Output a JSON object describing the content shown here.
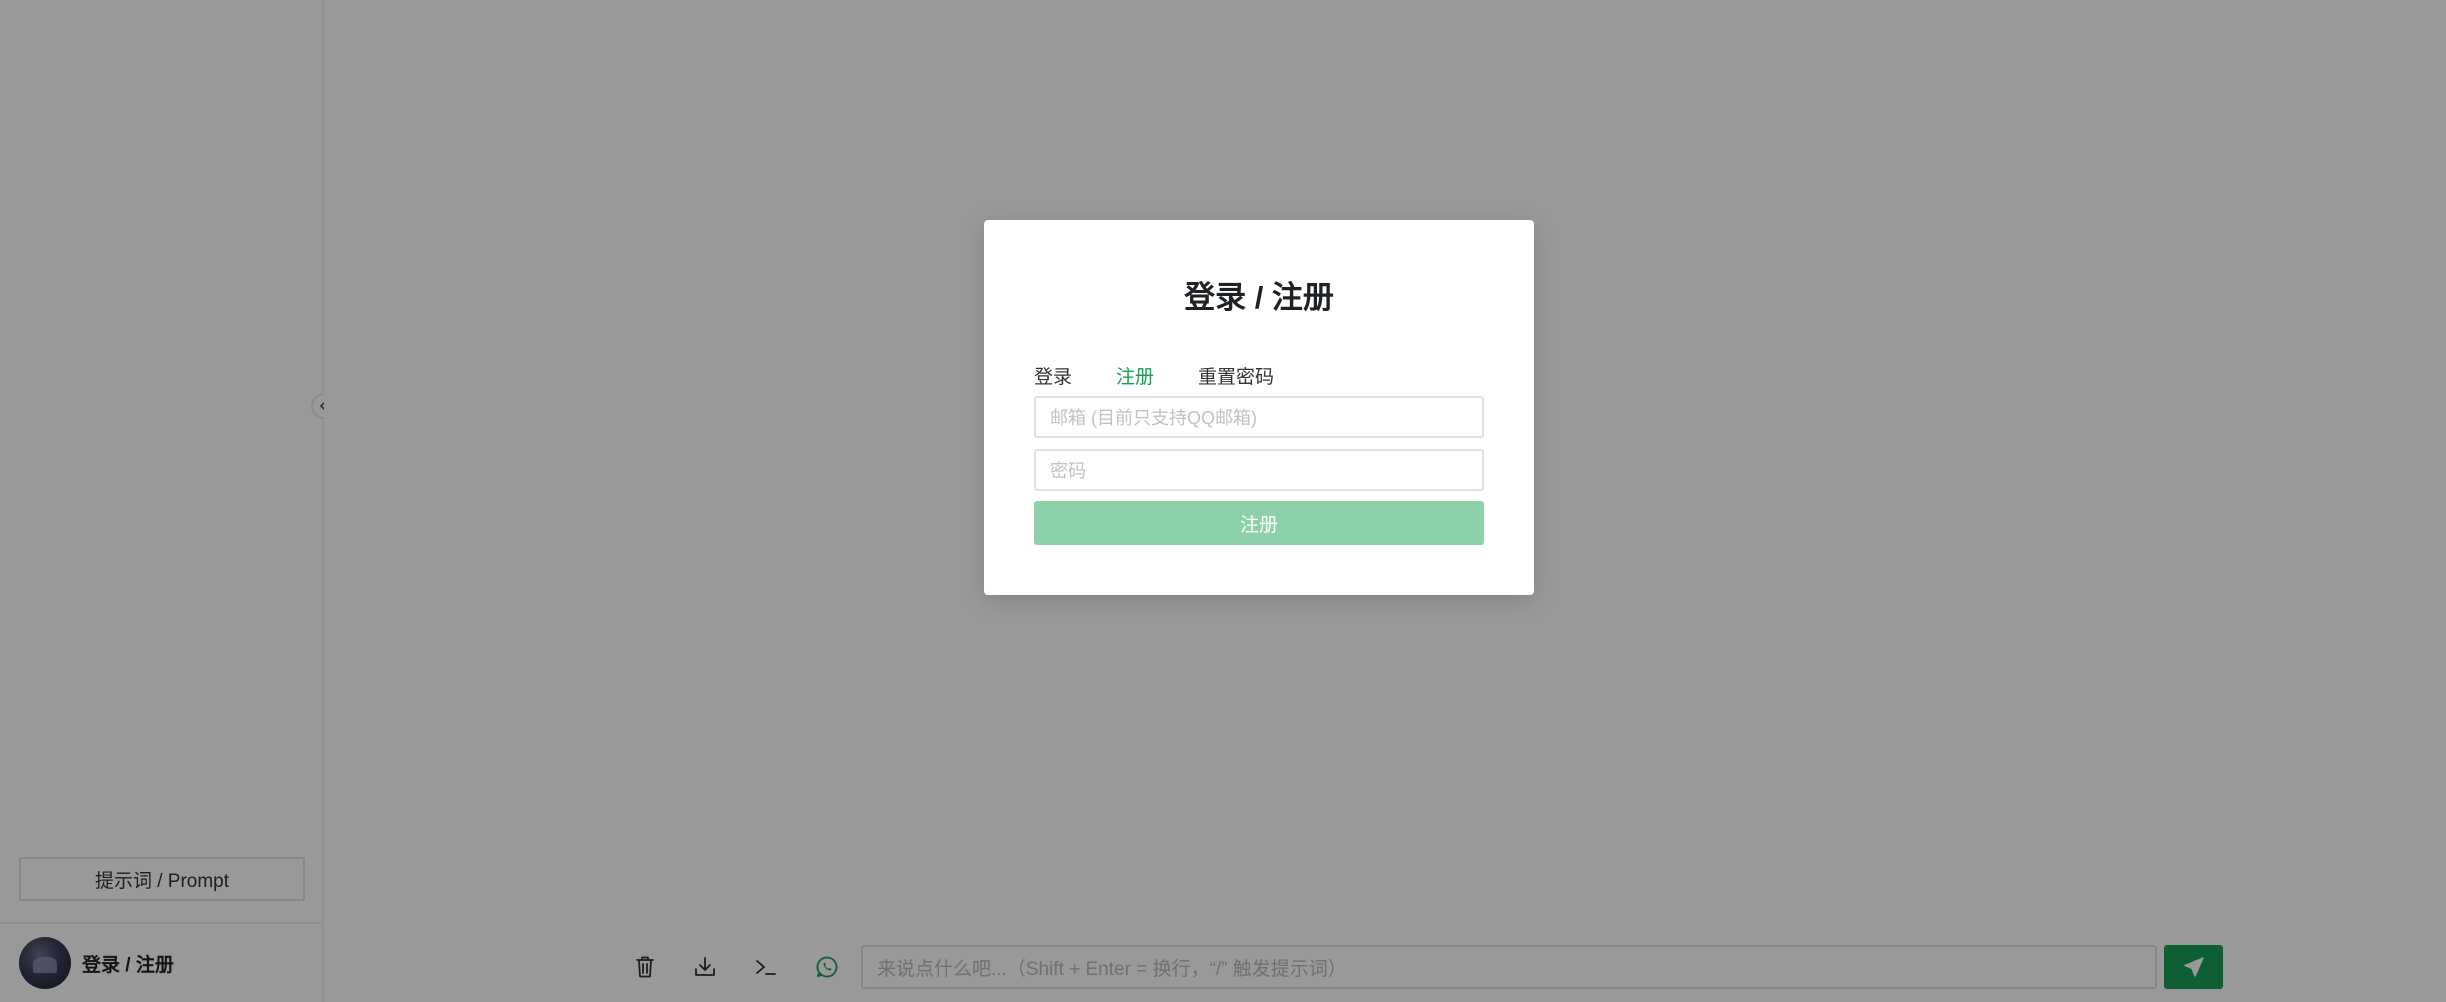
{
  "sidebar": {
    "prompt_button_label": "提示词 / Prompt",
    "user_label": "登录 / 注册"
  },
  "footer": {
    "input_placeholder": "来说点什么吧...（Shift + Enter = 换行，“/” 触发提示词）",
    "tools": [
      "delete-icon",
      "download-icon",
      "terminal-icon",
      "whatsapp-icon"
    ],
    "send_icon": "send-icon"
  },
  "modal": {
    "title": "登录 / 注册",
    "tabs": [
      {
        "label": "登录",
        "active": false
      },
      {
        "label": "注册",
        "active": true
      },
      {
        "label": "重置密码",
        "active": false
      }
    ],
    "email_placeholder": "邮箱 (目前只支持QQ邮箱)",
    "password_placeholder": "密码",
    "submit_label": "注册"
  },
  "colors": {
    "accent": "#18a058",
    "accent_disabled": "#8cd1a9",
    "overlay": "rgba(0,0,0,0.4)"
  }
}
